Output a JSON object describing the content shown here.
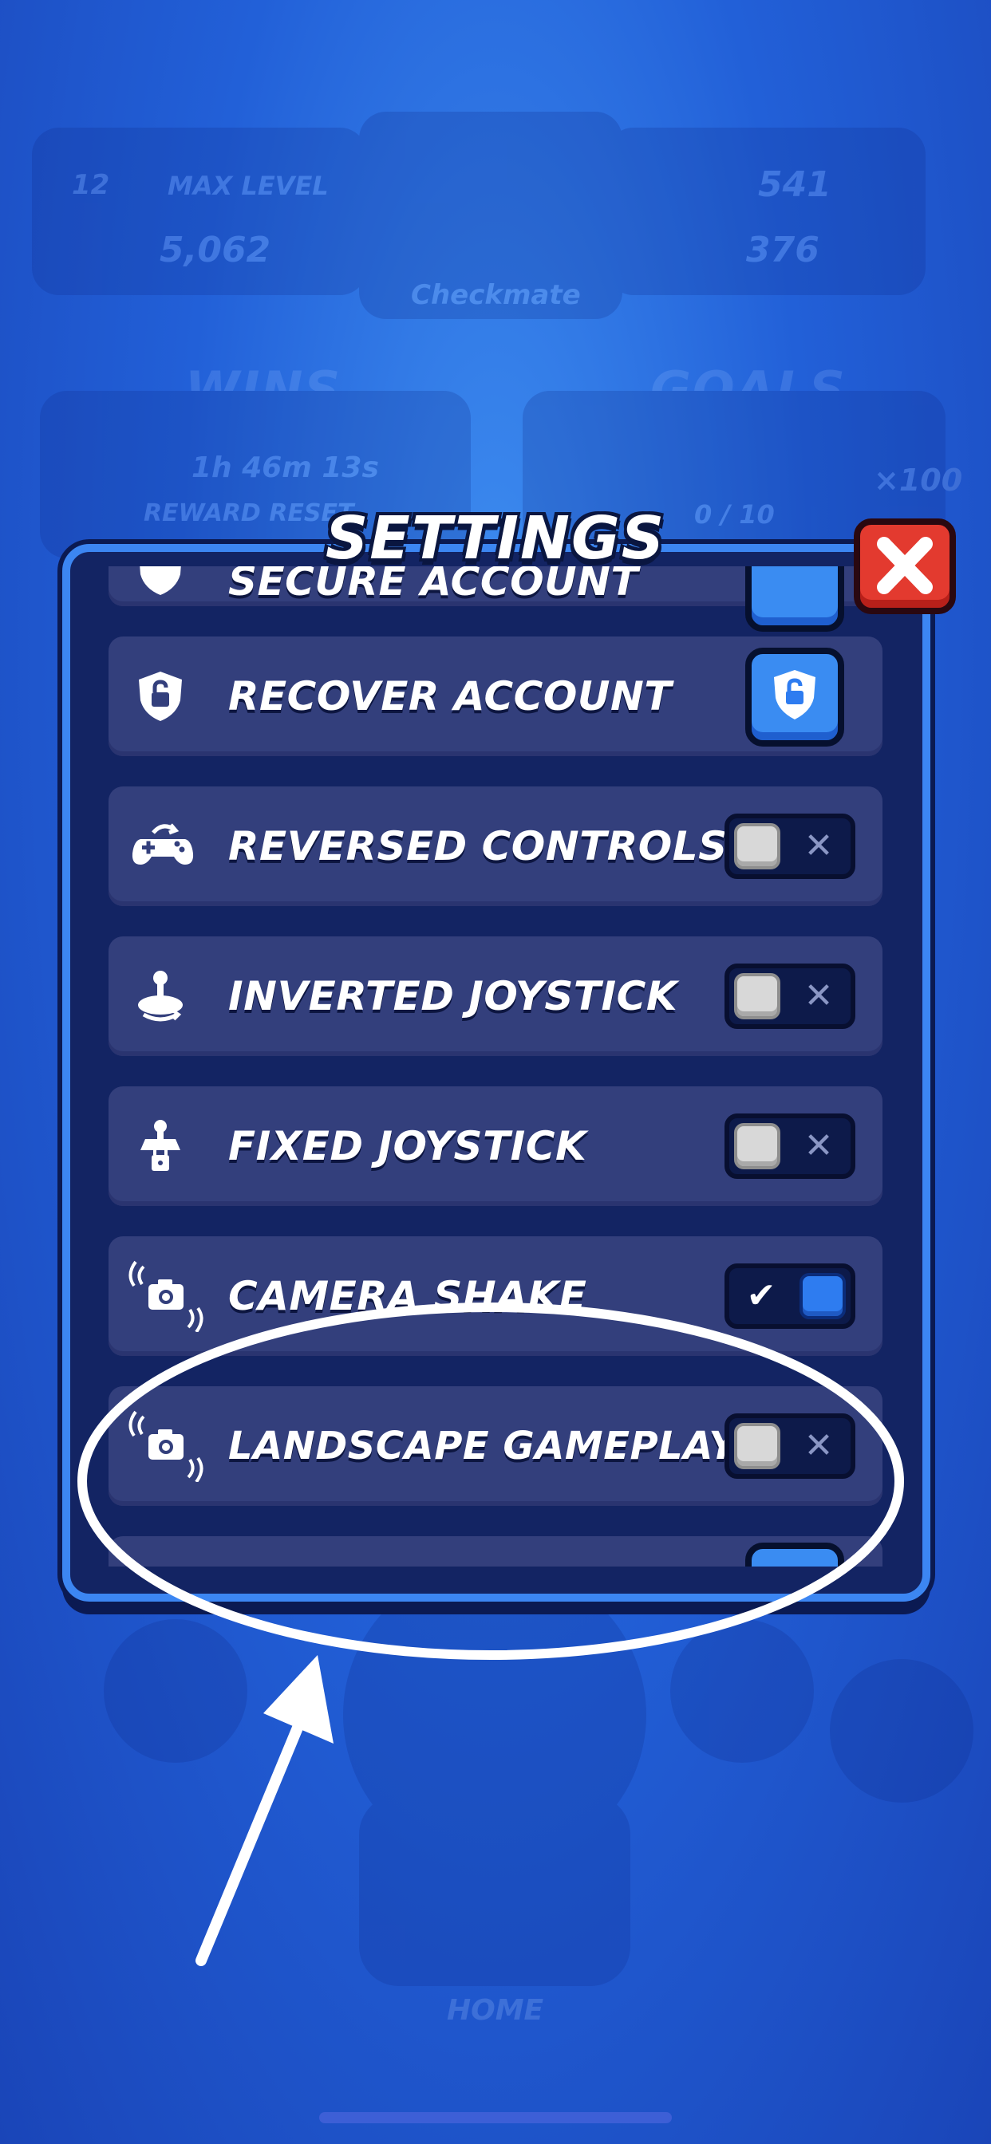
{
  "background": {
    "player_level": "12",
    "max_level_label": "MAX LEVEL",
    "gems": "5,062",
    "trophies": "541",
    "coins": "376",
    "brawler_name": "Checkmate",
    "wins_title": "WINS",
    "timer": "1h 46m 13s",
    "reward_reset_label": "REWARD RESET",
    "goals_title": "GOALS",
    "goals_progress": "0 / 10",
    "goals_reward": "×100",
    "home_label": "HOME"
  },
  "settings": {
    "title": "SETTINGS",
    "close_icon": "close-x-icon",
    "rows": [
      {
        "label": "SECURE ACCOUNT",
        "icon": "shield-icon",
        "control": "button"
      },
      {
        "label": "RECOVER ACCOUNT",
        "icon": "shield-lock-icon",
        "control": "button"
      },
      {
        "label": "REVERSED CONTROLS",
        "icon": "gamepad-icon",
        "control": "toggle",
        "state": "off",
        "mark": "✕"
      },
      {
        "label": "INVERTED JOYSTICK",
        "icon": "joystick-icon",
        "control": "toggle",
        "state": "off",
        "mark": "✕"
      },
      {
        "label": "FIXED JOYSTICK",
        "icon": "joystick-lock-icon",
        "control": "toggle",
        "state": "off",
        "mark": "✕"
      },
      {
        "label": "CAMERA SHAKE",
        "icon": "camera-shake-icon",
        "control": "toggle",
        "state": "on",
        "mark": "✔"
      },
      {
        "label": "LANDSCAPE GAMEPLAY",
        "icon": "camera-shake-icon",
        "control": "toggle",
        "state": "off",
        "mark": "✕"
      }
    ]
  },
  "colors": {
    "panel_bg": "#132463",
    "row_bg": "#333f7c",
    "accent_blue": "#3a8cf2",
    "close_red": "#e33a2f",
    "annotation_white": "#ffffff"
  }
}
